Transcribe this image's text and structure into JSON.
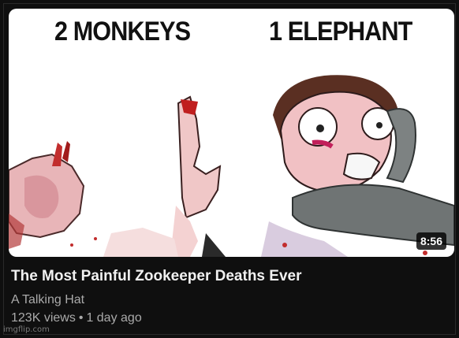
{
  "video": {
    "thumbnail": {
      "left_caption": "2 MONKEYS",
      "right_caption": "1 ELEPHANT",
      "duration": "8:56",
      "bg_color": "#ffffff"
    },
    "title": "The Most Painful Zookeeper Deaths Ever",
    "channel": "A Talking Hat",
    "views": "123K views",
    "separator": "•",
    "age": "1 day ago"
  },
  "watermark": "imgflip.com",
  "colors": {
    "page_bg": "#0f0f0f",
    "title_text": "#f1f1f1",
    "secondary_text": "#aaaaaa"
  }
}
